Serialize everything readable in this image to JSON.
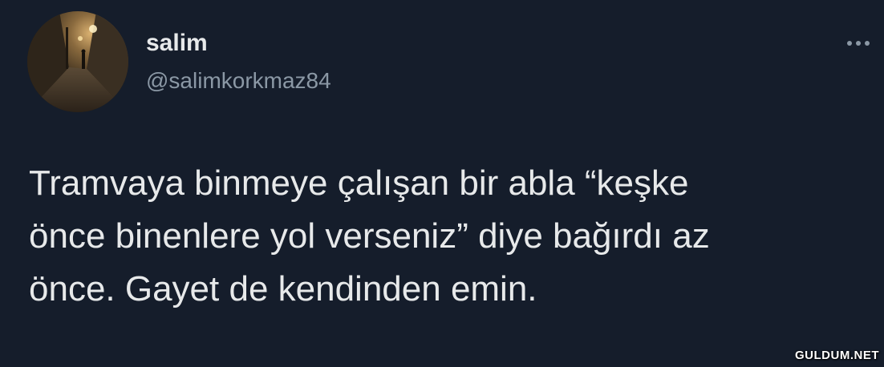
{
  "tweet": {
    "author": {
      "display_name": "salim",
      "handle": "@salimkorkmaz84",
      "avatar": "night-street-photo"
    },
    "more_icon": "more-horizontal-icon",
    "text_lines": [
      "Tramvaya binmeye çalışan bir abla “keşke",
      "önce binenlere yol verseniz” diye bağırdı az",
      "önce. Gayet de kendinden emin."
    ]
  },
  "watermark": "GULDUM.NET",
  "colors": {
    "background": "#151d2b",
    "text_primary": "#e7e9ea",
    "text_secondary": "#8b98a5"
  }
}
